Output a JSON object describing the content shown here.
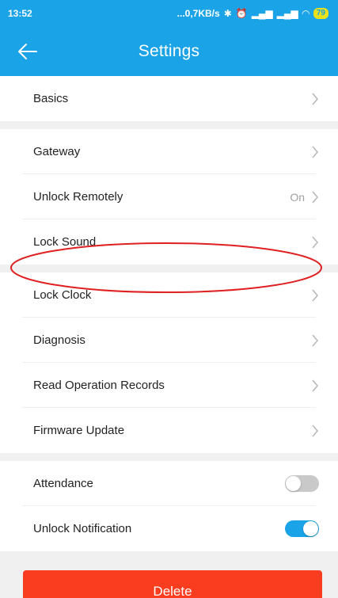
{
  "status_bar": {
    "time": "13:52",
    "network_speed": "...0,7KB/s",
    "battery": "79"
  },
  "header": {
    "title": "Settings",
    "back_icon": "arrow-left-icon"
  },
  "sections": [
    {
      "items": [
        {
          "label": "Basics",
          "value": ""
        }
      ]
    },
    {
      "items": [
        {
          "label": "Gateway",
          "value": ""
        },
        {
          "label": "Unlock Remotely",
          "value": "On"
        },
        {
          "label": "Lock Sound",
          "value": ""
        }
      ]
    },
    {
      "items": [
        {
          "label": "Lock Clock",
          "value": ""
        },
        {
          "label": "Diagnosis",
          "value": ""
        },
        {
          "label": "Read Operation Records",
          "value": ""
        },
        {
          "label": "Firmware Update",
          "value": ""
        }
      ]
    },
    {
      "items": [
        {
          "label": "Attendance",
          "toggle": false
        },
        {
          "label": "Unlock Notification",
          "toggle": true
        }
      ]
    }
  ],
  "delete_button": {
    "label": "Delete"
  },
  "colors": {
    "accent": "#1aa3e6",
    "danger": "#fa3d1e",
    "highlight": "#e02020"
  }
}
